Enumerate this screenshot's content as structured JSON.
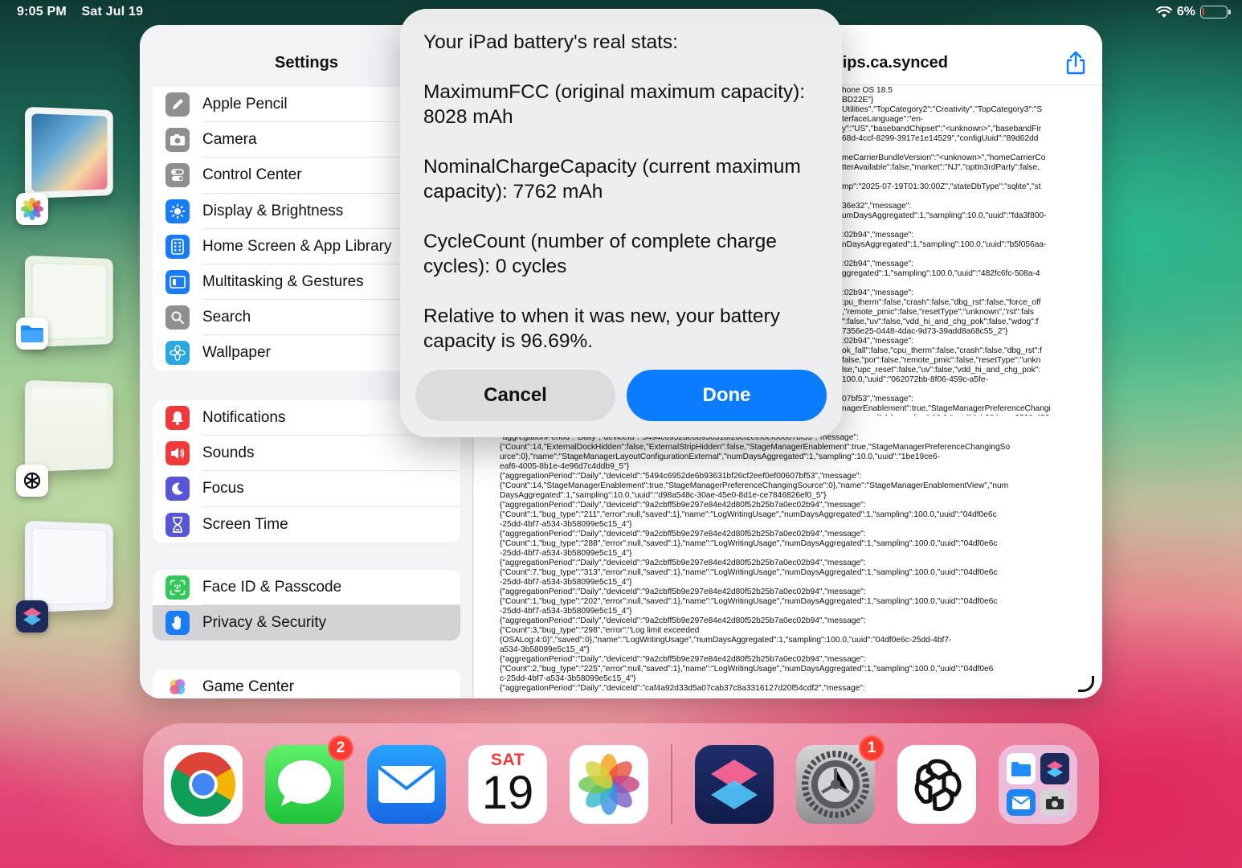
{
  "status_bar": {
    "time": "9:05 PM",
    "date": "Sat Jul 19",
    "battery_percent": "6%",
    "battery_level": 0.06
  },
  "stage_manager": [
    {
      "app": "Photos",
      "icon": "photos-icon"
    },
    {
      "app": "Files",
      "icon": "files-icon"
    },
    {
      "app": "ChatGPT",
      "icon": "chatgpt-icon"
    },
    {
      "app": "Shortcuts",
      "icon": "shortcuts-icon"
    }
  ],
  "settings": {
    "title": "Settings",
    "groups": [
      [
        {
          "label": "Apple Pencil",
          "icon": "pencil-icon",
          "color": "#8e8e93"
        },
        {
          "label": "Camera",
          "icon": "camera-icon",
          "color": "#8e8e93"
        },
        {
          "label": "Control Center",
          "icon": "switches-icon",
          "color": "#8e8e93"
        },
        {
          "label": "Display & Brightness",
          "icon": "sun-icon",
          "color": "#1a7cf5"
        },
        {
          "label": "Home Screen & App Library",
          "icon": "home-grid-icon",
          "color": "#1a7cf5"
        },
        {
          "label": "Multitasking & Gestures",
          "icon": "multitasking-icon",
          "color": "#1a7cf5"
        },
        {
          "label": "Search",
          "icon": "magnifier-icon",
          "color": "#8e8e93"
        },
        {
          "label": "Wallpaper",
          "icon": "flower-icon",
          "color": "#2aa7e0"
        }
      ],
      [
        {
          "label": "Notifications",
          "icon": "bell-icon",
          "color": "#f0393b"
        },
        {
          "label": "Sounds",
          "icon": "speaker-icon",
          "color": "#f0393b"
        },
        {
          "label": "Focus",
          "icon": "moon-icon",
          "color": "#5856d6"
        },
        {
          "label": "Screen Time",
          "icon": "hourglass-icon",
          "color": "#5856d6"
        }
      ],
      [
        {
          "label": "Face ID & Passcode",
          "icon": "faceid-icon",
          "color": "#34c759"
        },
        {
          "label": "Privacy & Security",
          "icon": "hand-icon",
          "color": "#1a7cf5",
          "selected": true
        }
      ],
      [
        {
          "label": "Game Center",
          "icon": "game-center-icon",
          "color": "#ffffff"
        }
      ]
    ]
  },
  "detail": {
    "title": "5.ips.ca.synced",
    "log_text": "hone OS 18.5\nBD22E\"}\nUtilities\",\"TopCategory2\":\"Creativity\",\"TopCategory3\":\"S\nterfaceLanguage\":\"en-\ny\":\"US\",\"basebandChipset\":\"<unknown>\",\"basebandFir\n68d-4ccf-8299-3917e1e14529\",\"configUuid\":\"89d62dd\n\nmeCarrierBundleVersion\":\"<unknown>\",\"homeCarrierCo\ntterAvailable\":false,\"market\":\"NJ\",\"optIn3rdParty\":false,\n\nmp\":\"2025-07-19T01:30:00Z\",\"stateDbType\":\"sqlite\",\"st\n\n36e32\",\"message\":\numDaysAggregated\":1,\"sampling\":10.0,\"uuid\":\"fda3f800-\n\n:02b94\",\"message\":\nnDaysAggregated\":1,\"sampling\":100.0,\"uuid\":\"b5f056aa-\n\n:02b94\",\"message\":\nggregated\":1,\"sampling\":100.0,\"uuid\":\"482fc6fc-508a-4\n\n:02b94\",\"message\":\n:pu_therm\":false,\"crash\":false,\"dbg_rst\":false,\"force_off\n,\"remote_pmic\":false,\"resetType\":\"unknown\",\"rst\":fals\n\":false,\"uv\":false,\"vdd_hi_and_chg_pok\":false,\"wdog\":f\n7356e25-0448-4dac-9d73-39add8a68c55_2\"}\n:02b94\",\"message\":\nok_fall\":false,\"cpu_therm\":false,\"crash\":false,\"dbg_rst\":f\nfalse,\"por\":false,\"remote_pmic\":false,\"resetType\":\"unkn\nlse,\"upc_reset\":false,\"uv\":false,\"vdd_hi_and_chg_pok\":\n100.0,\"uuid\":\"062072bb-8f06-459c-a5fe-\n\n07bf53\",\"message\":\nnagerEnablement\":true,\"StageManagerPreferenceChangi\nggregated\":1,\"sampling\":10.0,\"uuid\":\"cb384aea-2599-452",
    "log_text_wide": "\"aggregationPeriod\":\"Daily\",\"deviceId\":\"5494c6952de6b93631bf26cf2eef0ef00607bf53\",\"message\":\n{\"Count\":14,\"ExternalDockHidden\":false,\"ExternalStripHidden\":false,\"StageManagerEnablement\":true,\"StageManagerPreferenceChangingSo\nurce\":0},\"name\":\"StageManagerLayoutConfigurationExternal\",\"numDaysAggregated\":1,\"sampling\":10.0,\"uuid\":\"1be19ce6-\neaf6-4005-8b1e-4e96d7c4ddb9_5\"}\n{\"aggregationPeriod\":\"Daily\",\"deviceId\":\"5494c6952de6b93631bf26cf2eef0ef00607bf53\",\"message\":\n{\"Count\":14,\"StageManagerEnablement\":true,\"StageManagerPreferenceChangingSource\":0},\"name\":\"StageManagerEnablementView\",\"num\nDaysAggregated\":1,\"sampling\":10.0,\"uuid\":\"d98a548c-30ae-45e0-8d1e-ce7846826ef0_5\"}\n{\"aggregationPeriod\":\"Daily\",\"deviceId\":\"9a2cbff5b9e297e84e42d80f52b25b7a0ec02b94\",\"message\":\n{\"Count\":1,\"bug_type\":\"211\",\"error\":null,\"saved\":1},\"name\":\"LogWritingUsage\",\"numDaysAggregated\":1,\"sampling\":100.0,\"uuid\":\"04df0e6c\n-25dd-4bf7-a534-3b58099e5c15_4\"}\n{\"aggregationPeriod\":\"Daily\",\"deviceId\":\"9a2cbff5b9e297e84e42d80f52b25b7a0ec02b94\",\"message\":\n{\"Count\":1,\"bug_type\":\"288\",\"error\":null,\"saved\":1},\"name\":\"LogWritingUsage\",\"numDaysAggregated\":1,\"sampling\":100.0,\"uuid\":\"04df0e6c\n-25dd-4bf7-a534-3b58099e5c15_4\"}\n{\"aggregationPeriod\":\"Daily\",\"deviceId\":\"9a2cbff5b9e297e84e42d80f52b25b7a0ec02b94\",\"message\":\n{\"Count\":7,\"bug_type\":\"313\",\"error\":null,\"saved\":1},\"name\":\"LogWritingUsage\",\"numDaysAggregated\":1,\"sampling\":100.0,\"uuid\":\"04df0e6c\n-25dd-4bf7-a534-3b58099e5c15_4\"}\n{\"aggregationPeriod\":\"Daily\",\"deviceId\":\"9a2cbff5b9e297e84e42d80f52b25b7a0ec02b94\",\"message\":\n{\"Count\":1,\"bug_type\":\"202\",\"error\":null,\"saved\":1},\"name\":\"LogWritingUsage\",\"numDaysAggregated\":1,\"sampling\":100.0,\"uuid\":\"04df0e6c\n-25dd-4bf7-a534-3b58099e5c15_4\"}\n{\"aggregationPeriod\":\"Daily\",\"deviceId\":\"9a2cbff5b9e297e84e42d80f52b25b7a0ec02b94\",\"message\":\n{\"Count\":3,\"bug_type\":\"298\",\"error\":\"Log limit exceeded\n(OSALog:4:0)\",\"saved\":0},\"name\":\"LogWritingUsage\",\"numDaysAggregated\":1,\"sampling\":100.0,\"uuid\":\"04df0e6c-25dd-4bf7-\na534-3b58099e5c15_4\"}\n{\"aggregationPeriod\":\"Daily\",\"deviceId\":\"9a2cbff5b9e297e84e42d80f52b25b7a0ec02b94\",\"message\":\n{\"Count\":2,\"bug_type\":\"225\",\"error\":null,\"saved\":1},\"name\":\"LogWritingUsage\",\"numDaysAggregated\":1,\"sampling\":100.0,\"uuid\":\"04df0e6\nc-25dd-4bf7-a534-3b58099e5c15_4\"}\n{\"aggregationPeriod\":\"Daily\",\"deviceId\":\"caf4a92d33d5a07cab37c8a3316127d20f54cdf2\",\"message\":"
  },
  "dialog": {
    "title": "Your iPad battery's real stats:",
    "line_fcc": "MaximumFCC (original maximum capacity): 8028 mAh",
    "line_nominal": "NominalChargeCapacity (current maximum capacity): 7762 mAh",
    "line_cycles": "CycleCount (number of complete charge cycles): 0 cycles",
    "line_relative": "Relative to when it was new, your battery capacity is 96.69%.",
    "cancel_label": "Cancel",
    "done_label": "Done"
  },
  "dock": {
    "apps": [
      {
        "name": "Chrome",
        "icon": "chrome-icon"
      },
      {
        "name": "Messages",
        "icon": "messages-icon",
        "badge": "2"
      },
      {
        "name": "Mail",
        "icon": "mail-icon"
      },
      {
        "name": "Calendar",
        "icon": "calendar-icon",
        "day": "SAT",
        "date": "19"
      },
      {
        "name": "Photos",
        "icon": "photos-icon"
      },
      {
        "name": "Shortcuts",
        "icon": "shortcuts-icon"
      },
      {
        "name": "Settings",
        "icon": "settings-gear-icon",
        "badge": "1"
      },
      {
        "name": "ChatGPT",
        "icon": "chatgpt-icon"
      },
      {
        "name": "App Library",
        "icon": "app-library-icon"
      }
    ]
  }
}
